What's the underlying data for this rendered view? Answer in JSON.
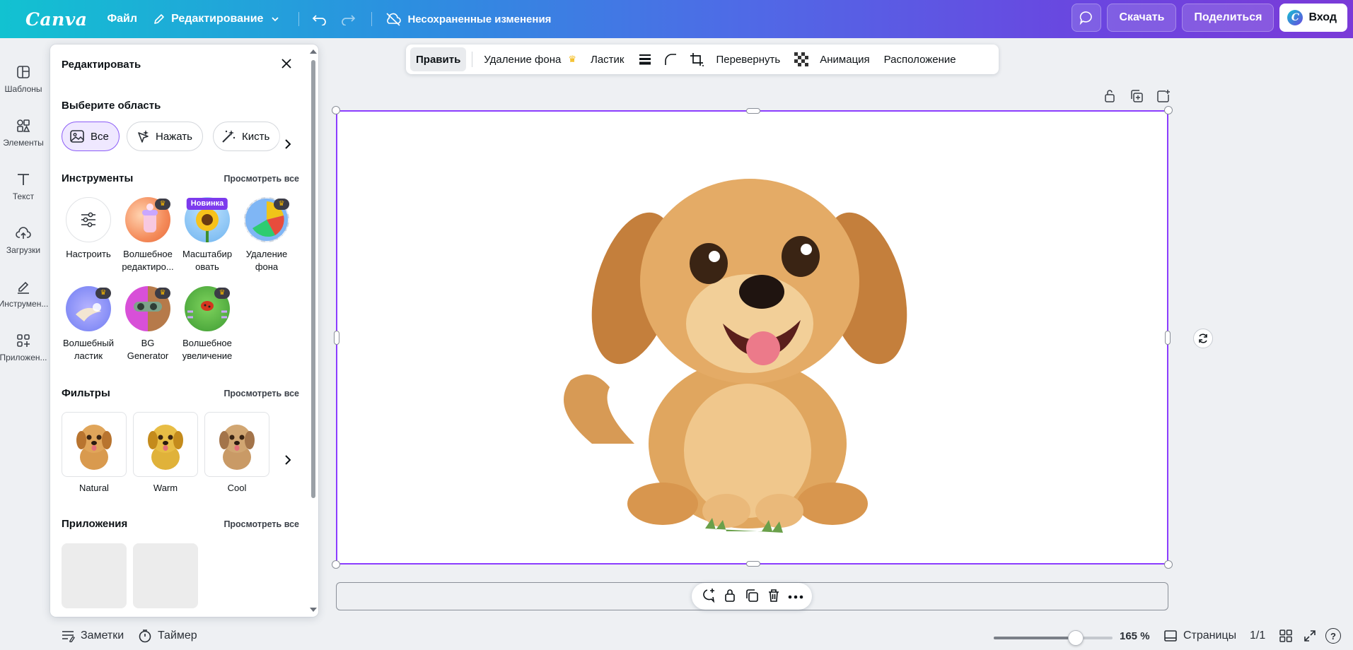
{
  "topbar": {
    "logo": "Canva",
    "file_label": "Файл",
    "edit_label": "Редактирование",
    "save_status": "Несохраненные изменения",
    "download_label": "Скачать",
    "share_label": "Поделиться",
    "login_label": "Вход",
    "login_badge": "C",
    "gradient_colors": [
      "#12c2d1",
      "#7a3ad8"
    ]
  },
  "rail": {
    "items": [
      {
        "label": "Шаблоны",
        "icon": "templates-icon"
      },
      {
        "label": "Элементы",
        "icon": "elements-icon"
      },
      {
        "label": "Текст",
        "icon": "text-icon"
      },
      {
        "label": "Загрузки",
        "icon": "uploads-icon"
      },
      {
        "label": "Инструмен...",
        "icon": "draw-icon"
      },
      {
        "label": "Приложен...",
        "icon": "apps-icon"
      }
    ]
  },
  "panel": {
    "title": "Редактировать",
    "area": {
      "label": "Выберите область",
      "chips": [
        {
          "label": "Все",
          "icon": "image-icon",
          "active": true
        },
        {
          "label": "Нажать",
          "icon": "click-sparkle-icon",
          "active": false
        },
        {
          "label": "Кисть",
          "icon": "magic-brush-icon",
          "active": false
        }
      ]
    },
    "tools": {
      "label": "Инструменты",
      "see_all": "Просмотреть все",
      "items": [
        {
          "label": "Настроить",
          "icon": "adjust-sliders-icon",
          "badge": ""
        },
        {
          "label": "Волшебное редактиро...",
          "icon": "magic-edit-icon",
          "badge": "crown"
        },
        {
          "label": "Масштабир овать",
          "icon": "upscale-sunflower-icon",
          "badge": "Новинка"
        },
        {
          "label": "Удаление фона",
          "icon": "bg-remover-icon",
          "badge": "crown"
        },
        {
          "label": "Волшебный ластик",
          "icon": "magic-eraser-icon",
          "badge": "crown"
        },
        {
          "label": "BG Generator",
          "icon": "bg-generator-icon",
          "badge": "crown"
        },
        {
          "label": "Волшебное увеличение",
          "icon": "magic-expand-icon",
          "badge": "crown"
        }
      ]
    },
    "filters": {
      "label": "Фильтры",
      "see_all": "Просмотреть все",
      "items": [
        {
          "label": "Natural"
        },
        {
          "label": "Warm"
        },
        {
          "label": "Cool"
        }
      ]
    },
    "apps": {
      "label": "Приложения",
      "see_all": "Просмотреть все"
    }
  },
  "context_toolbar": {
    "edit": "Править",
    "bg_remove": "Удаление фона",
    "eraser": "Ластик",
    "flip": "Перевернуть",
    "animate": "Анимация",
    "position": "Расположение"
  },
  "bottombar": {
    "notes": "Заметки",
    "timer": "Таймер",
    "zoom": "165 %",
    "zoom_fraction": 0.69,
    "pages": "Страницы",
    "page_count": "1/1",
    "help": "?"
  },
  "accent_color": "#8b3dff"
}
